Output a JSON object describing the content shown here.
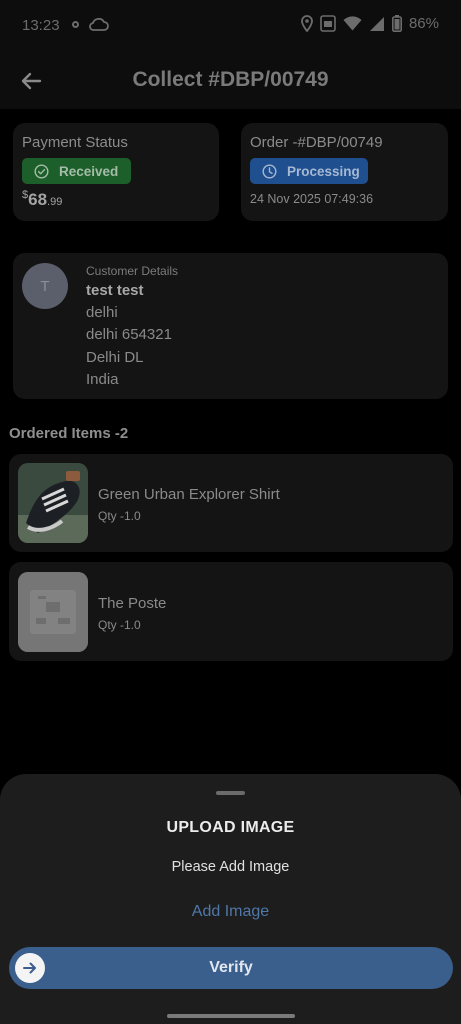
{
  "status_bar": {
    "time": "13:23",
    "battery": "86%",
    "icons": [
      "notification-dot-icon",
      "cloud-icon",
      "location-icon",
      "wifi-icon",
      "signal-icon",
      "battery-icon"
    ]
  },
  "app_bar": {
    "title": "Collect #DBP/00749",
    "back_icon": "arrow-left-icon"
  },
  "payment": {
    "label": "Payment Status",
    "status": "Received",
    "currency": "$",
    "amount_whole": "68",
    "amount_decimal": ".99",
    "status_color": "#1d5f2a"
  },
  "order": {
    "label": "Order -#DBP/00749",
    "status": "Processing",
    "datetime": "24 Nov 2025 07:49:36",
    "status_color": "#1f4f8f"
  },
  "customer": {
    "heading": "Customer Details",
    "avatar_letter": "T",
    "name": "test test",
    "address_lines": [
      "delhi",
      "delhi 654321",
      "Delhi DL",
      "India"
    ]
  },
  "items_section": {
    "title": "Ordered Items -2",
    "items": [
      {
        "name": "Green Urban Explorer Shirt",
        "qty": "Qty  -1.0"
      },
      {
        "name": "The Poste",
        "qty": "Qty  -1.0"
      }
    ]
  },
  "sheet": {
    "title": "UPLOAD IMAGE",
    "subtitle": "Please Add Image",
    "add_image": "Add Image",
    "verify": "Verify",
    "accent": "#3b5f8c"
  }
}
